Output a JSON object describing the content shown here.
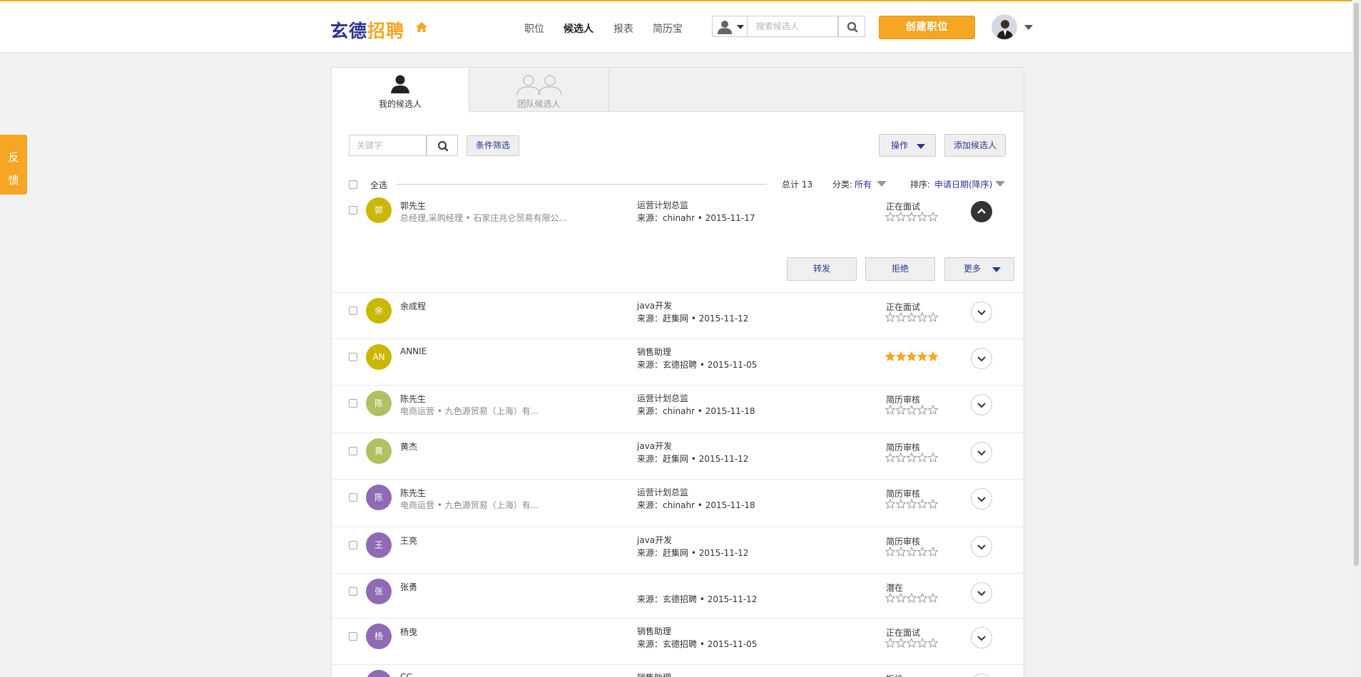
{
  "header": {
    "logo_part1": "玄德",
    "logo_part2": "招聘",
    "nav": [
      "职位",
      "候选人",
      "报表",
      "简历宝"
    ],
    "active_nav": "候选人",
    "search_placeholder": "搜索候选人",
    "create_button": "创建职位"
  },
  "feedback": [
    "反",
    "馈"
  ],
  "tabs": {
    "mine": "我的候选人",
    "team": "团队候选人"
  },
  "toolbar": {
    "keyword_placeholder": "关键字",
    "filter_button": "条件筛选",
    "operation_button": "操作",
    "add_button": "添加候选人"
  },
  "list_header": {
    "select_all": "全选",
    "total": "总计 13",
    "category_label": "分类:",
    "category_value": "所有",
    "sort_label": "排序:",
    "sort_value": "申请日期(降序)"
  },
  "row_actions": {
    "forward": "转发",
    "reject": "拒绝",
    "more": "更多"
  },
  "candidates": [
    {
      "initial": "郭",
      "name": "郭先生",
      "sub": "总经理,采购经理  •  石家庄兆仑贸易有限公...",
      "position": "运营计划总监",
      "source": "来源：chinahr  •  2015-11-17",
      "status": "正在面试",
      "rating": 0,
      "color": "#c9b700",
      "expanded": true
    },
    {
      "initial": "余",
      "name": "余成程",
      "sub": "",
      "position": "java开发",
      "source": "来源：赶集网  •  2015-11-12",
      "status": "正在面试",
      "rating": 0,
      "color": "#c9b700",
      "expanded": false
    },
    {
      "initial": "AN",
      "name": "ANNIE",
      "sub": "",
      "position": "销售助理",
      "source": "来源：玄德招聘  •  2015-11-05",
      "status": "",
      "rating": 5,
      "color": "#c9b700",
      "expanded": false
    },
    {
      "initial": "陈",
      "name": "陈先生",
      "sub": "电商运营  •  九色源贸易（上海）有...",
      "position": "运营计划总监",
      "source": "来源：chinahr  •  2015-11-18",
      "status": "简历审核",
      "rating": 0,
      "color": "#b2c061",
      "expanded": false
    },
    {
      "initial": "黄",
      "name": "黄杰",
      "sub": "",
      "position": "java开发",
      "source": "来源：赶集网  •  2015-11-12",
      "status": "简历审核",
      "rating": 0,
      "color": "#b2c061",
      "expanded": false
    },
    {
      "initial": "陈",
      "name": "陈先生",
      "sub": "电商运营  •  九色源贸易（上海）有...",
      "position": "运营计划总监",
      "source": "来源：chinahr  •  2015-11-18",
      "status": "简历审核",
      "rating": 0,
      "color": "#8e6bb4",
      "expanded": false
    },
    {
      "initial": "王",
      "name": "王亮",
      "sub": "",
      "position": "java开发",
      "source": "来源：赶集网  •  2015-11-12",
      "status": "简历审核",
      "rating": 0,
      "color": "#8e6bb4",
      "expanded": false
    },
    {
      "initial": "张",
      "name": "张勇",
      "sub": "",
      "position": "",
      "source": "来源：玄德招聘  •  2015-11-12",
      "status": "潜在",
      "rating": 0,
      "color": "#8e6bb4",
      "expanded": false
    },
    {
      "initial": "杨",
      "name": "杨曳",
      "sub": "",
      "position": "销售助理",
      "source": "来源：玄德招聘  •  2015-11-05",
      "status": "正在面试",
      "rating": 0,
      "color": "#8e6bb4",
      "expanded": false
    },
    {
      "initial": "CC",
      "name": "CC",
      "sub": "",
      "position": "销售助理",
      "source": "",
      "status": "拒绝",
      "rating": 0,
      "color": "#8e6bb4",
      "expanded": false
    }
  ],
  "colors": {
    "accent": "#f5a623",
    "brand": "#2c3592"
  }
}
